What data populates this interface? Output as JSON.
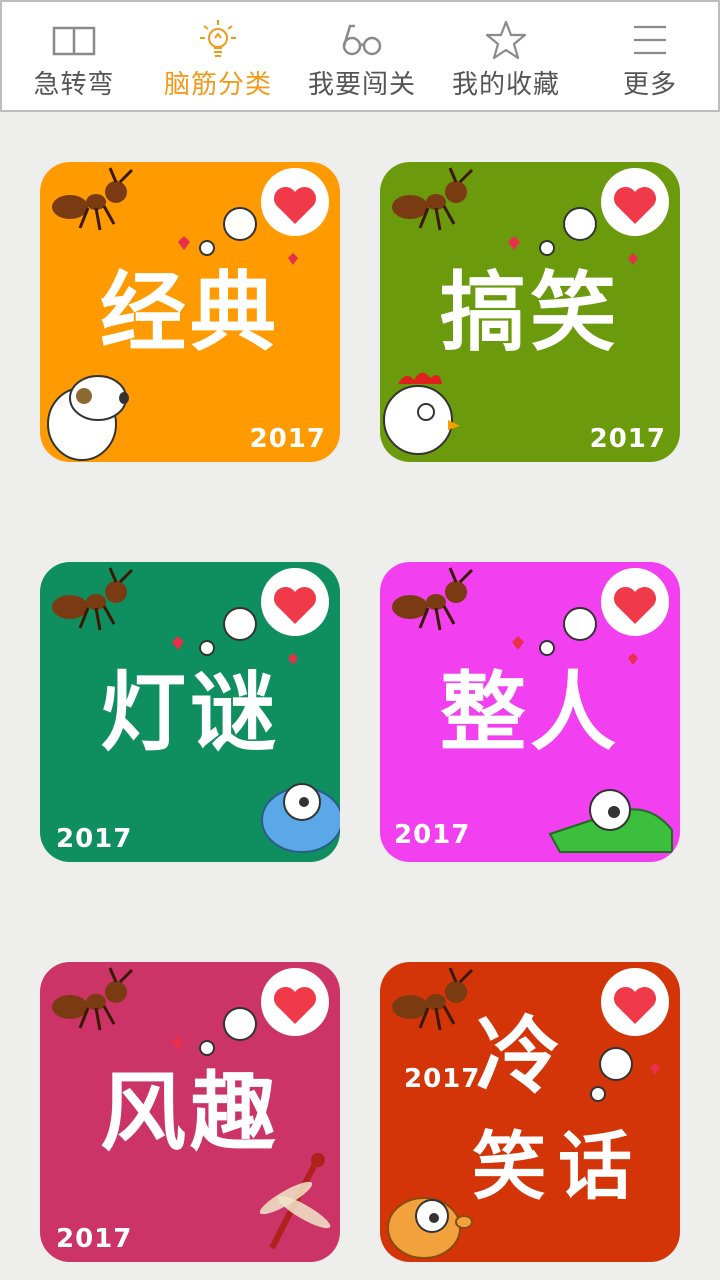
{
  "tabs": [
    {
      "label": "急转弯",
      "icon": "book-icon",
      "active": false
    },
    {
      "label": "脑筋分类",
      "icon": "lightbulb-icon",
      "active": true
    },
    {
      "label": "我要闯关",
      "icon": "glasses-icon",
      "active": false
    },
    {
      "label": "我的收藏",
      "icon": "star-icon",
      "active": false
    },
    {
      "label": "更多",
      "icon": "menu-icon",
      "active": false
    }
  ],
  "colors": {
    "accent": "#f29a1c",
    "tab_text": "#555555",
    "background": "#eeeeec"
  },
  "cards": [
    {
      "title": "经典",
      "year": "2017",
      "color": "#ff9a00",
      "mascot": "dog-icon"
    },
    {
      "title": "搞笑",
      "year": "2017",
      "color": "#6b9a0c",
      "mascot": "chicken-icon"
    },
    {
      "title": "灯谜",
      "year": "2017",
      "color": "#0f8f5f",
      "mascot": "bird-icon"
    },
    {
      "title": "整人",
      "year": "2017",
      "color": "#f23ff0",
      "mascot": "crocodile-icon"
    },
    {
      "title": "风趣",
      "year": "2017",
      "color": "#cc3366",
      "mascot": "dragonfly-icon"
    },
    {
      "title_top": "冷",
      "title_bottom": "笑话",
      "year": "2017",
      "color": "#d43508",
      "mascot": "puppy-icon"
    }
  ]
}
